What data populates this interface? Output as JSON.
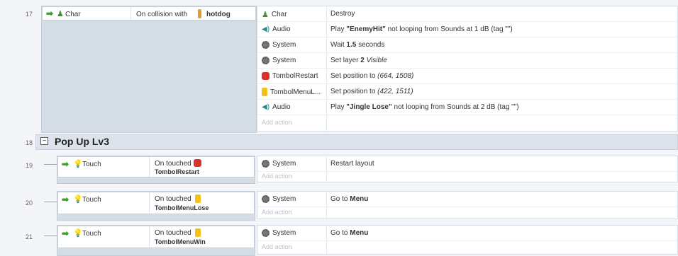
{
  "events": [
    {
      "number": "17",
      "condition": {
        "object": "Char",
        "text": "On collision with",
        "target": "hotdog"
      },
      "actions": [
        {
          "object": "Char",
          "icon": "char-icon",
          "html": "Destroy"
        },
        {
          "object": "Audio",
          "icon": "audio-icon",
          "html": "Play <b>\"EnemyHit\"</b> not looping from Sounds at 1 dB (tag \"\")"
        },
        {
          "object": "System",
          "icon": "gear-icon",
          "html": "Wait <b>1.5</b> seconds"
        },
        {
          "object": "System",
          "icon": "gear-icon",
          "html": "Set layer <b>2</b> <i>Visible</i>"
        },
        {
          "object": "TombolRestart",
          "icon": "restart-button-icon",
          "html": "Set position to <i>(664, 1508)</i>"
        },
        {
          "object": "TombolMenuL...",
          "icon": "menu-button-icon",
          "html": "Set position to <i>(422, 1511)</i>"
        },
        {
          "object": "Audio",
          "icon": "audio-icon",
          "html": "Play <b>\"Jingle Lose\"</b> not looping from Sounds at 2 dB (tag \"\")"
        }
      ],
      "add_action": "Add action"
    },
    {
      "number": "19",
      "condition": {
        "object": "Touch",
        "text": "On touched",
        "target": "TombolRestart"
      },
      "actions": [
        {
          "object": "System",
          "icon": "gear-icon",
          "html": "Restart layout"
        }
      ],
      "add_action": "Add action"
    },
    {
      "number": "20",
      "condition": {
        "object": "Touch",
        "text": "On touched",
        "target": "TombolMenuLose"
      },
      "actions": [
        {
          "object": "System",
          "icon": "gear-icon",
          "html": "Go to <b>Menu</b>"
        }
      ],
      "add_action": "Add action"
    },
    {
      "number": "21",
      "condition": {
        "object": "Touch",
        "text": "On touched",
        "target": "TombolMenuWin"
      },
      "actions": [
        {
          "object": "System",
          "icon": "gear-icon",
          "html": "Go to <b>Menu</b>"
        }
      ],
      "add_action": "Add action"
    }
  ],
  "group": {
    "number": "18",
    "title": "Pop Up Lv3",
    "expander": "−"
  }
}
